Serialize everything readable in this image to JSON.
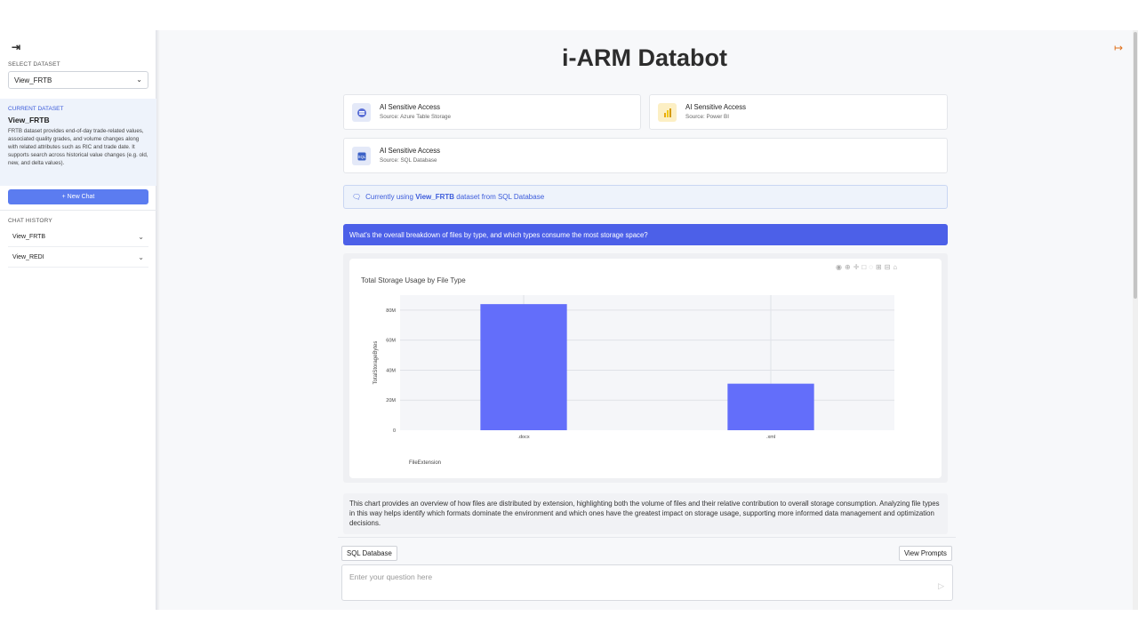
{
  "sidebar": {
    "select_dataset_label": "SELECT DATASET",
    "selected_dataset": "View_FRTB",
    "current_dataset_label": "CURRENT DATASET",
    "current_dataset_name": "View_FRTB",
    "current_dataset_description": "FRTB dataset provides end-of-day trade-related values, associated quality grades, and volume changes along with related attributes such as RIC and trade date. It supports search across historical value changes (e.g. old, new, and delta values).",
    "new_chat_label": "+ New Chat",
    "chat_history_label": "CHAT HISTORY",
    "history": [
      {
        "label": "View_FRTB"
      },
      {
        "label": "View_REDI"
      }
    ]
  },
  "header": {
    "title": "i-ARM Databot"
  },
  "sources": [
    {
      "title": "AI Sensitive Access",
      "subtitle": "Source: Azure Table Storage",
      "icon": "azure-table-icon",
      "color": "#e4e9f8"
    },
    {
      "title": "AI Sensitive Access",
      "subtitle": "Source: Power BI",
      "icon": "power-bi-icon",
      "color": "#fcefc4"
    },
    {
      "title": "AI Sensitive Access",
      "subtitle": "Source: SQL Database",
      "icon": "sql-database-icon",
      "color": "#e4e9f8"
    }
  ],
  "info_bar": {
    "prefix": "Currently using ",
    "dataset": "View_FRTB",
    "suffix": " dataset from SQL Database"
  },
  "question": "What's the overall breakdown of files by type, and which types consume the most storage space?",
  "chart_data": {
    "type": "bar",
    "title": "Total Storage Usage by File Type",
    "xlabel": "FileExtension",
    "ylabel": "TotalStorageBytes",
    "categories": [
      ".docx",
      ".xml"
    ],
    "values": [
      84000000,
      31000000
    ],
    "ylim": [
      0,
      90000000
    ],
    "yticks": [
      0,
      20000000,
      40000000,
      60000000,
      80000000
    ],
    "ytick_labels": [
      "0",
      "20M",
      "40M",
      "60M",
      "80M"
    ],
    "grid": true,
    "color": "#636efa"
  },
  "summary": "This chart provides an overview of how files are distributed by extension, highlighting both the volume of files and their relative contribution to overall storage consumption. Analyzing file types in this way helps identify which formats dominate the environment and which ones have the greatest impact on storage usage, supporting more informed data management and optimization decisions.",
  "bottom": {
    "source_pill": "SQL Database",
    "view_prompts": "View Prompts",
    "input_placeholder": "Enter your question here"
  },
  "colors": {
    "accent": "#4c60e8",
    "new_chat": "#5b7cf0",
    "logout": "#e0701c"
  }
}
